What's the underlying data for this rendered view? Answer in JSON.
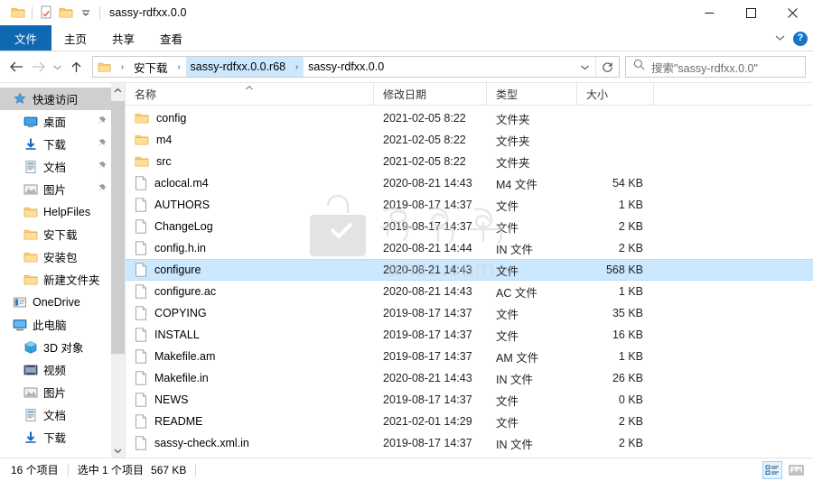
{
  "window": {
    "title": "sassy-rdfxx.0.0",
    "quick_access_icons": [
      "folder-icon",
      "properties-icon",
      "new-folder-icon",
      "customize-chevron-icon"
    ],
    "controls": {
      "minimize": "minimize-icon",
      "maximize": "maximize-icon",
      "close": "close-icon"
    }
  },
  "ribbon": {
    "tabs": [
      {
        "label": "文件",
        "active": true
      },
      {
        "label": "主页",
        "active": false
      },
      {
        "label": "共享",
        "active": false
      },
      {
        "label": "查看",
        "active": false
      }
    ],
    "collapse_icon": "chevron-down-icon",
    "help_label": "?"
  },
  "address": {
    "back_icon": "back-arrow-icon",
    "forward_icon": "forward-arrow-icon",
    "recent_icon": "chevron-down-icon",
    "up_icon": "up-arrow-icon",
    "breadcrumbs": [
      {
        "label": "安下载",
        "highlighted": false
      },
      {
        "label": "sassy-rdfxx.0.0.r68",
        "highlighted": true
      },
      {
        "label": "sassy-rdfxx.0.0",
        "highlighted": false
      }
    ],
    "dropdown_icon": "chevron-down-icon",
    "refresh_icon": "refresh-icon"
  },
  "search": {
    "icon": "search-icon",
    "placeholder": "搜索\"sassy-rdfxx.0.0\""
  },
  "sidebar": {
    "items": [
      {
        "label": "快速访问",
        "icon": "star-pin-icon",
        "level": 0,
        "selected": true,
        "pinned": false
      },
      {
        "label": "桌面",
        "icon": "desktop-icon",
        "level": 1,
        "selected": false,
        "pinned": true
      },
      {
        "label": "下载",
        "icon": "download-icon",
        "level": 1,
        "selected": false,
        "pinned": true
      },
      {
        "label": "文档",
        "icon": "documents-icon",
        "level": 1,
        "selected": false,
        "pinned": true
      },
      {
        "label": "图片",
        "icon": "pictures-icon",
        "level": 1,
        "selected": false,
        "pinned": true
      },
      {
        "label": "HelpFiles",
        "icon": "folder-icon",
        "level": 1,
        "selected": false,
        "pinned": false
      },
      {
        "label": "安下载",
        "icon": "folder-icon",
        "level": 1,
        "selected": false,
        "pinned": false
      },
      {
        "label": "安装包",
        "icon": "folder-icon",
        "level": 1,
        "selected": false,
        "pinned": false
      },
      {
        "label": "新建文件夹",
        "icon": "folder-icon",
        "level": 1,
        "selected": false,
        "pinned": false
      },
      {
        "label": "OneDrive",
        "icon": "onedrive-icon",
        "level": 0,
        "selected": false,
        "pinned": false
      },
      {
        "label": "此电脑",
        "icon": "this-pc-icon",
        "level": 0,
        "selected": false,
        "pinned": false
      },
      {
        "label": "3D 对象",
        "icon": "3d-objects-icon",
        "level": 1,
        "selected": false,
        "pinned": false
      },
      {
        "label": "视频",
        "icon": "videos-icon",
        "level": 1,
        "selected": false,
        "pinned": false
      },
      {
        "label": "图片",
        "icon": "pictures-icon",
        "level": 1,
        "selected": false,
        "pinned": false
      },
      {
        "label": "文档",
        "icon": "documents-icon",
        "level": 1,
        "selected": false,
        "pinned": false
      },
      {
        "label": "下载",
        "icon": "download-icon",
        "level": 1,
        "selected": false,
        "pinned": false
      }
    ],
    "scrollbar": {
      "up_icon": "chevron-up-icon",
      "down_icon": "chevron-down-icon"
    }
  },
  "filelist": {
    "columns": [
      {
        "label": "名称",
        "sorted": "asc"
      },
      {
        "label": "修改日期",
        "sorted": ""
      },
      {
        "label": "类型",
        "sorted": ""
      },
      {
        "label": "大小",
        "sorted": ""
      }
    ],
    "rows": [
      {
        "name": "config",
        "date": "2021-02-05 8:22",
        "type": "文件夹",
        "size": "",
        "icon": "folder-icon",
        "selected": false
      },
      {
        "name": "m4",
        "date": "2021-02-05 8:22",
        "type": "文件夹",
        "size": "",
        "icon": "folder-icon",
        "selected": false
      },
      {
        "name": "src",
        "date": "2021-02-05 8:22",
        "type": "文件夹",
        "size": "",
        "icon": "folder-icon",
        "selected": false
      },
      {
        "name": "aclocal.m4",
        "date": "2020-08-21 14:43",
        "type": "M4 文件",
        "size": "54 KB",
        "icon": "file-icon",
        "selected": false
      },
      {
        "name": "AUTHORS",
        "date": "2019-08-17 14:37",
        "type": "文件",
        "size": "1 KB",
        "icon": "file-icon",
        "selected": false
      },
      {
        "name": "ChangeLog",
        "date": "2019-08-17 14:37",
        "type": "文件",
        "size": "2 KB",
        "icon": "file-icon",
        "selected": false
      },
      {
        "name": "config.h.in",
        "date": "2020-08-21 14:44",
        "type": "IN 文件",
        "size": "2 KB",
        "icon": "file-icon",
        "selected": false
      },
      {
        "name": "configure",
        "date": "2020-08-21 14:43",
        "type": "文件",
        "size": "568 KB",
        "icon": "file-icon",
        "selected": true
      },
      {
        "name": "configure.ac",
        "date": "2020-08-21 14:43",
        "type": "AC 文件",
        "size": "1 KB",
        "icon": "file-icon",
        "selected": false
      },
      {
        "name": "COPYING",
        "date": "2019-08-17 14:37",
        "type": "文件",
        "size": "35 KB",
        "icon": "file-icon",
        "selected": false
      },
      {
        "name": "INSTALL",
        "date": "2019-08-17 14:37",
        "type": "文件",
        "size": "16 KB",
        "icon": "file-icon",
        "selected": false
      },
      {
        "name": "Makefile.am",
        "date": "2019-08-17 14:37",
        "type": "AM 文件",
        "size": "1 KB",
        "icon": "file-icon",
        "selected": false
      },
      {
        "name": "Makefile.in",
        "date": "2020-08-21 14:43",
        "type": "IN 文件",
        "size": "26 KB",
        "icon": "file-icon",
        "selected": false
      },
      {
        "name": "NEWS",
        "date": "2019-08-17 14:37",
        "type": "文件",
        "size": "0 KB",
        "icon": "file-icon",
        "selected": false
      },
      {
        "name": "README",
        "date": "2021-02-01 14:29",
        "type": "文件",
        "size": "2 KB",
        "icon": "file-icon",
        "selected": false
      },
      {
        "name": "sassy-check.xml.in",
        "date": "2019-08-17 14:37",
        "type": "IN 文件",
        "size": "2 KB",
        "icon": "file-icon",
        "selected": false
      }
    ]
  },
  "watermark": {
    "text": "安下载",
    "subtext": "anxz.com"
  },
  "statusbar": {
    "item_count": "16 个项目",
    "selection": "选中 1 个项目",
    "selection_size": "567 KB",
    "views": [
      {
        "name": "details-view",
        "active": true
      },
      {
        "name": "large-icons-view",
        "active": false
      }
    ]
  },
  "colors": {
    "accent": "#0e69b2",
    "selection": "#cce8ff",
    "folder": "#ffd175",
    "nav_selected": "#cfcfcf"
  }
}
